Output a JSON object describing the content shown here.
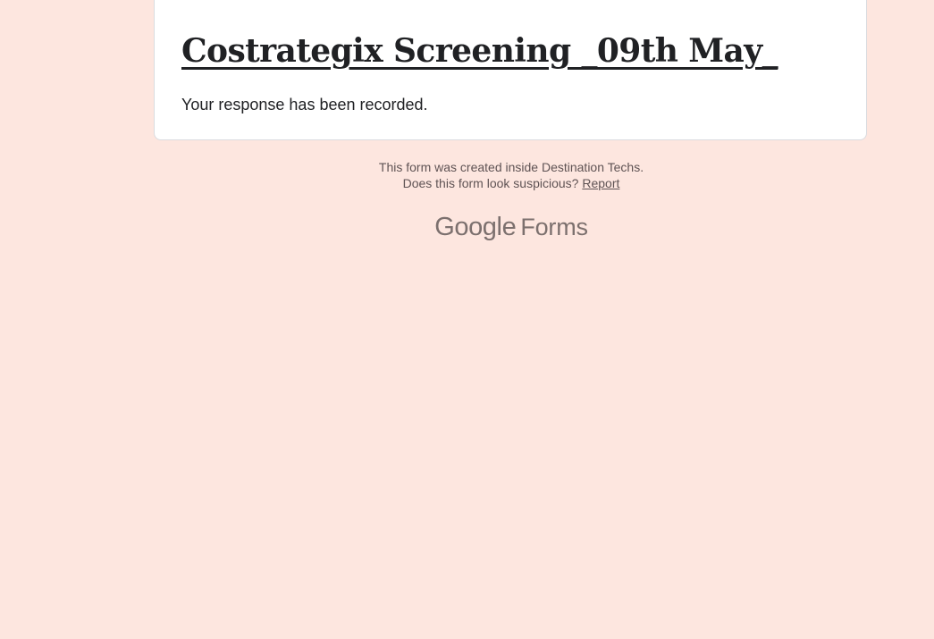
{
  "form": {
    "title": "Costrategix Screening _09th May_",
    "confirmation": "Your response has been recorded."
  },
  "footer": {
    "created_text": "This form was created inside Destination Techs.",
    "suspicious_text": "Does this form look suspicious?",
    "report_link": "Report"
  },
  "branding": {
    "google": "Google",
    "forms": "Forms"
  },
  "colors": {
    "background": "#fde6df",
    "card": "#ffffff",
    "text": "#202124",
    "footer_text": "#5f5354",
    "logo": "#7c706e"
  }
}
